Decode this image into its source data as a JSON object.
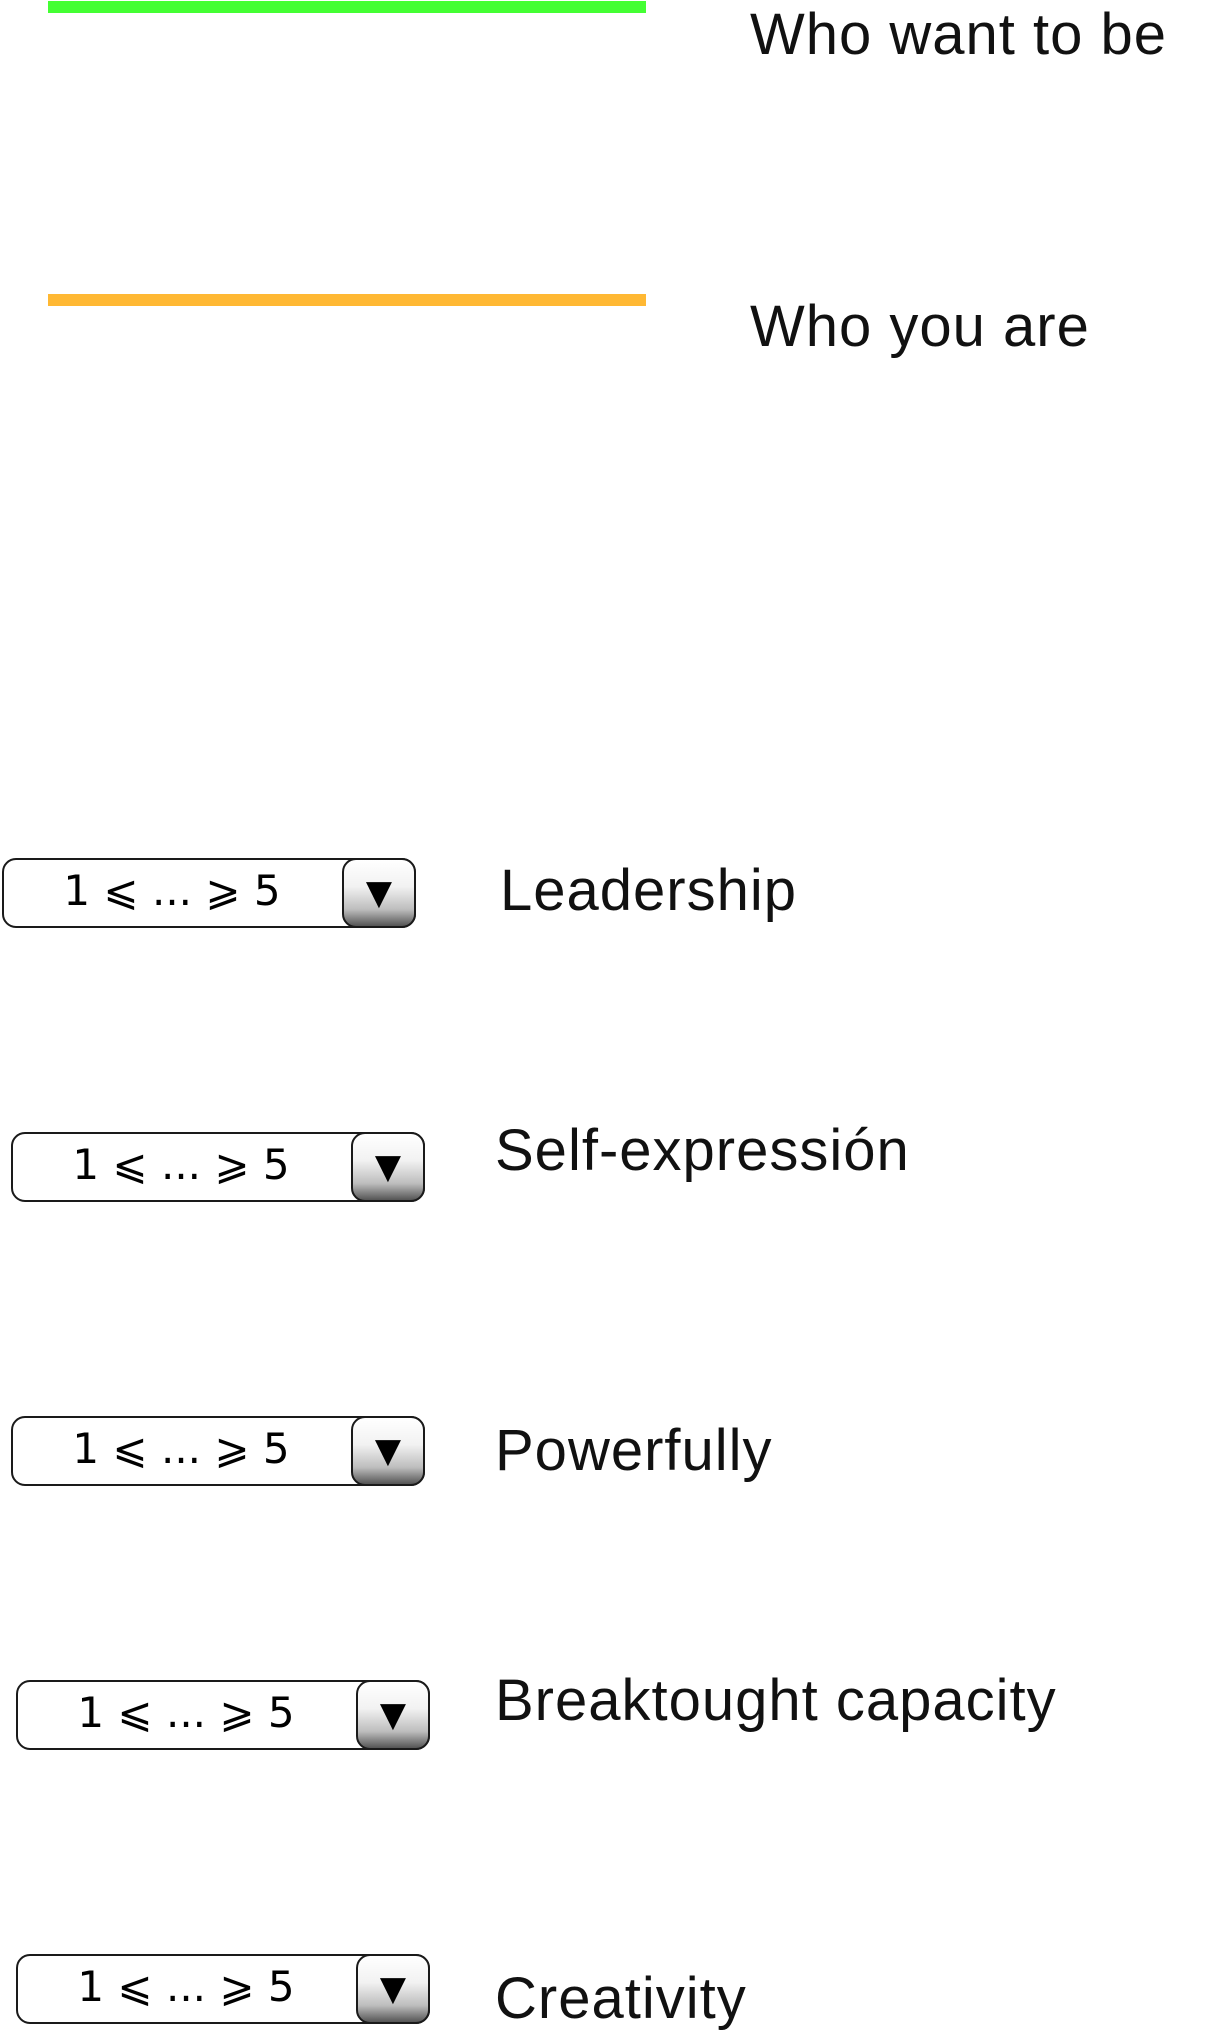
{
  "legend": [
    {
      "id": "want",
      "label": "Who want to be",
      "color": "#44ff33"
    },
    {
      "id": "are",
      "label": "Who you are",
      "color": "#ffb833"
    }
  ],
  "dropdown": {
    "value": "1 ⩽ ... ⩾ 5",
    "arrow_icon": "▼",
    "arrow_icon_name": "triangle-down-icon"
  },
  "rows": [
    {
      "label": "Leadership"
    },
    {
      "label": "Self-expressión"
    },
    {
      "label": "Powerfully"
    },
    {
      "label": "Breaktought capacity"
    },
    {
      "label": "Creativity"
    }
  ]
}
